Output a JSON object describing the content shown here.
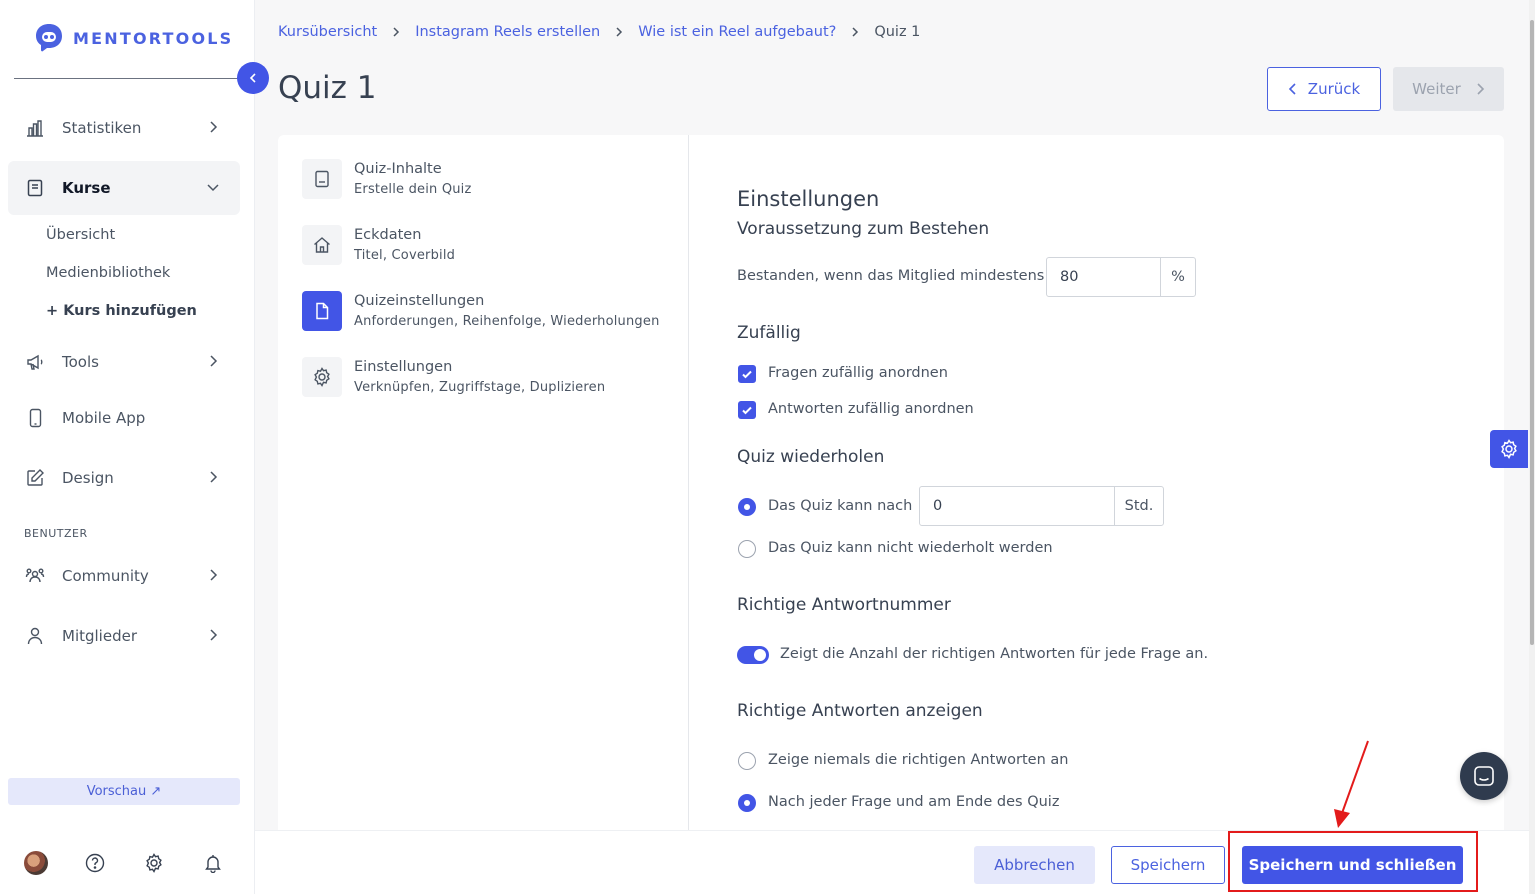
{
  "brand": {
    "name": "MENTORTOOLS",
    "color": "#4b62e0"
  },
  "colors": {
    "primary": "#4255e6",
    "annotation": "#e31b1b"
  },
  "sidebar": {
    "nav": [
      {
        "label": "Statistiken",
        "icon": "bar-chart-icon"
      },
      {
        "label": "Kurse",
        "icon": "book-icon",
        "active": true,
        "expanded": true
      },
      {
        "label": "Tools",
        "icon": "megaphone-icon"
      },
      {
        "label": "Mobile App",
        "icon": "mobile-icon"
      },
      {
        "label": "Design",
        "icon": "pencil-icon"
      },
      {
        "label": "Community",
        "icon": "users-icon"
      },
      {
        "label": "Mitglieder",
        "icon": "user-icon"
      }
    ],
    "sub": [
      "Übersicht",
      "Medienbibliothek",
      "+ Kurs hinzufügen"
    ],
    "section_label": "BENUTZER",
    "preview": "Vorschau ↗"
  },
  "breadcrumb": [
    "Kursübersicht",
    "Instagram Reels erstellen",
    "Wie ist ein Reel aufgebaut?",
    "Quiz 1"
  ],
  "page_title": "Quiz 1",
  "nav_buttons": {
    "back": "Zurück",
    "next": "Weiter"
  },
  "steps": [
    {
      "title": "Quiz-Inhalte",
      "subtitle": "Erstelle dein Quiz",
      "icon": "document-icon"
    },
    {
      "title": "Eckdaten",
      "subtitle": "Titel, Coverbild",
      "icon": "home-icon"
    },
    {
      "title": "Quizeinstellungen",
      "subtitle": "Anforderungen, Reihenfolge, Wiederholungen",
      "icon": "file-icon",
      "active": true
    },
    {
      "title": "Einstellungen",
      "subtitle": "Verknüpfen, Zugriffstage, Duplizieren",
      "icon": "gear-icon"
    }
  ],
  "settings": {
    "heading": "Einstellungen",
    "pass": {
      "heading": "Voraussetzung zum Bestehen",
      "label": "Bestanden, wenn das Mitglied mindestens",
      "value": "80",
      "unit": "%"
    },
    "random": {
      "heading": "Zufällig",
      "opt1": "Fragen zufällig anordnen",
      "opt2": "Antworten zufällig anordnen",
      "opt1_checked": true,
      "opt2_checked": true
    },
    "repeat": {
      "heading": "Quiz wiederholen",
      "opt1": "Das Quiz kann nach",
      "value": "0",
      "unit": "Std.",
      "opt2": "Das Quiz kann nicht wiederholt werden",
      "selected": 1
    },
    "answer_number": {
      "heading": "Richtige Antwortnummer",
      "label": "Zeigt die Anzahl der richtigen Antworten für jede Frage an.",
      "enabled": true
    },
    "show_answers": {
      "heading": "Richtige Antworten anzeigen",
      "opt1": "Zeige niemals die richtigen Antworten an",
      "opt2": "Nach jeder Frage und am Ende des Quiz",
      "selected": 2
    }
  },
  "footer": {
    "cancel": "Abbrechen",
    "save": "Speichern",
    "save_close": "Speichern und schließen"
  }
}
